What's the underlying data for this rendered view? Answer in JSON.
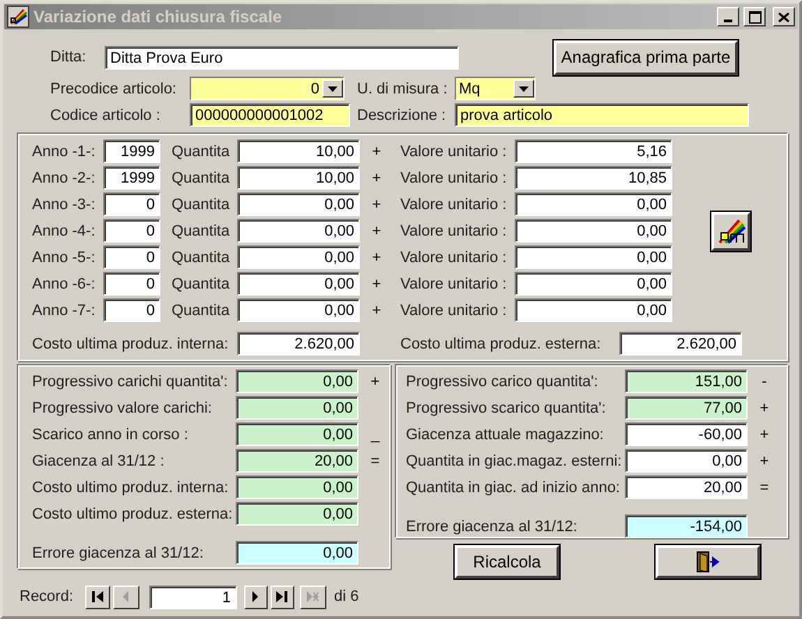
{
  "window": {
    "title": "Variazione dati chiusura fiscale"
  },
  "header": {
    "ditta_label": "Ditta:",
    "ditta": "Ditta Prova Euro",
    "anagrafica_button": "Anagrafica prima parte",
    "precodice_label": "Precodice articolo:",
    "precodice": "0",
    "um_label": "U. di misura :",
    "um": "Mq",
    "codice_label": "Codice articolo :",
    "codice": "000000000001002",
    "descrizione_label": "Descrizione :",
    "descrizione": "prova articolo"
  },
  "years": [
    {
      "label": "Anno -1-:",
      "year": "1999",
      "qty_label": "Quantita",
      "qty": "10,00",
      "sign": "+",
      "unit_label": "Valore unitario :",
      "unit_value": "5,16"
    },
    {
      "label": "Anno -2-:",
      "year": "1999",
      "qty_label": "Quantita",
      "qty": "10,00",
      "sign": "+",
      "unit_label": "Valore unitario :",
      "unit_value": "10,85"
    },
    {
      "label": "Anno -3-:",
      "year": "0",
      "qty_label": "Quantita",
      "qty": "0,00",
      "sign": "+",
      "unit_label": "Valore unitario :",
      "unit_value": "0,00"
    },
    {
      "label": "Anno -4-:",
      "year": "0",
      "qty_label": "Quantita",
      "qty": "0,00",
      "sign": "+",
      "unit_label": "Valore unitario :",
      "unit_value": "0,00"
    },
    {
      "label": "Anno -5-:",
      "year": "0",
      "qty_label": "Quantita",
      "qty": "0,00",
      "sign": "+",
      "unit_label": "Valore unitario :",
      "unit_value": "0,00"
    },
    {
      "label": "Anno -6-:",
      "year": "0",
      "qty_label": "Quantita",
      "qty": "0,00",
      "sign": "+",
      "unit_label": "Valore unitario :",
      "unit_value": "0,00"
    },
    {
      "label": "Anno -7-:",
      "year": "0",
      "qty_label": "Quantita",
      "qty": "0,00",
      "sign": "+",
      "unit_label": "Valore unitario :",
      "unit_value": "0,00"
    }
  ],
  "costs": {
    "internal_label": "Costo ultima produz. interna:",
    "internal": "2.620,00",
    "external_label": "Costo ultima produz. esterna:",
    "external": "2.620,00"
  },
  "left_summary": [
    {
      "label": "Progressivo carichi quantita':",
      "value": "0,00",
      "sign": "+",
      "color": "#ccf2cc"
    },
    {
      "label": "Progressivo valore carichi:",
      "value": "0,00",
      "color": "#ccf2cc"
    },
    {
      "label": "Scarico anno in corso :",
      "value": "0,00",
      "sign": "_",
      "color": "#ccf2cc"
    },
    {
      "label": "Giacenza al 31/12 :",
      "value": "20,00",
      "sign": "=",
      "color": "#ccf2cc"
    },
    {
      "label": "Costo ultimo produz. interna:",
      "value": "0,00",
      "color": "#ccf2cc"
    },
    {
      "label": "Costo ultimo produz. esterna:",
      "value": "0,00",
      "color": "#ccf2cc"
    }
  ],
  "left_error": {
    "label": "Errore giacenza al 31/12:",
    "value": "0,00",
    "color": "#ccffff"
  },
  "right_summary": [
    {
      "label": "Progressivo carico quantita':",
      "value": "151,00",
      "sign": "-",
      "color": "#ccf2cc"
    },
    {
      "label": "Progressivo scarico quantita':",
      "value": "77,00",
      "sign": "+",
      "color": "#ccf2cc"
    },
    {
      "label": "Giacenza attuale magazzino:",
      "value": "-60,00",
      "sign": "+",
      "color": "#ffffff"
    },
    {
      "label": "Quantita in giac.magaz. esterni:",
      "value": "0,00",
      "sign": "+",
      "color": "#ffffff"
    },
    {
      "label": "Quantita in giac. ad inizio anno:",
      "value": "20,00",
      "sign": "=",
      "color": "#ffffff"
    }
  ],
  "right_error": {
    "label": "Errore giacenza al 31/12:",
    "value": "-154,00",
    "color": "#ccffff"
  },
  "recalc_button": "Ricalcola",
  "record_nav": {
    "label": "Record:",
    "value": "1",
    "total": "di 6",
    "buttons": [
      {
        "kind": "first",
        "disabled": false
      },
      {
        "kind": "prev",
        "disabled": true
      },
      {
        "kind": "next",
        "disabled": false
      },
      {
        "kind": "last",
        "disabled": false
      },
      {
        "kind": "new",
        "disabled": true
      }
    ]
  }
}
